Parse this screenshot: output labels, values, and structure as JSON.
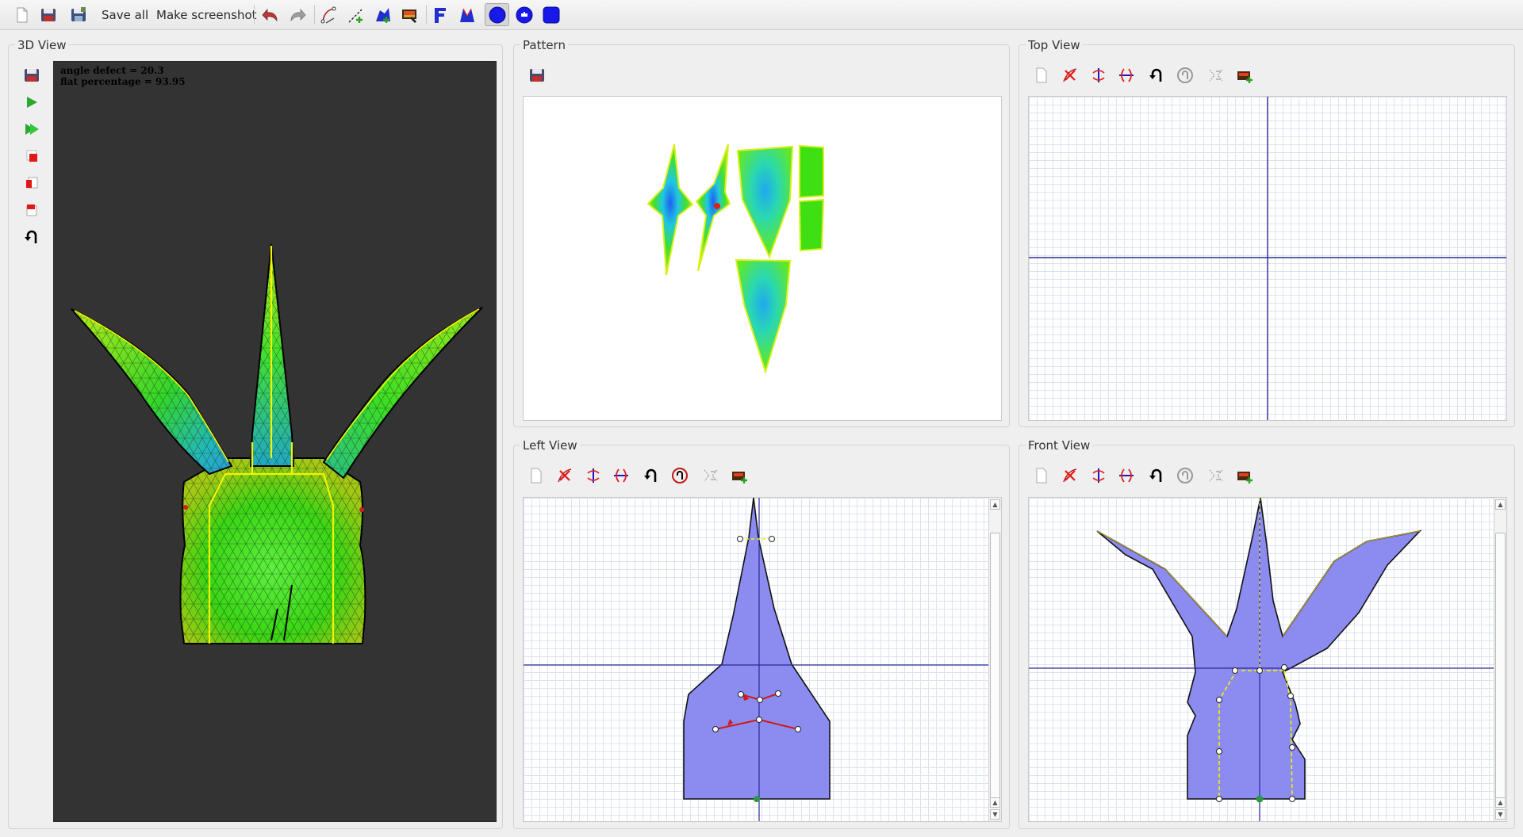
{
  "toolbar": {
    "save_all_label": "Save all",
    "make_screenshot_label": "Make screenshot"
  },
  "panels": {
    "view3d": {
      "title": "3D View",
      "overlay": {
        "angle_defect": "angle defect = 20.3",
        "flat_percentage": "flat percentage = 93.95"
      }
    },
    "pattern": {
      "title": "Pattern"
    },
    "top_view": {
      "title": "Top View"
    },
    "left_view": {
      "title": "Left View"
    },
    "front_view": {
      "title": "Front View"
    }
  },
  "colors": {
    "mesh_green": "#39e20c",
    "mesh_cyan": "#1fb8c8",
    "seam_yellow": "#f3f306",
    "sketch_fill": "#8c8cf0",
    "axis_blue": "#2a2a9a",
    "spring_red": "#d11818",
    "viewport_bg": "#333333"
  }
}
